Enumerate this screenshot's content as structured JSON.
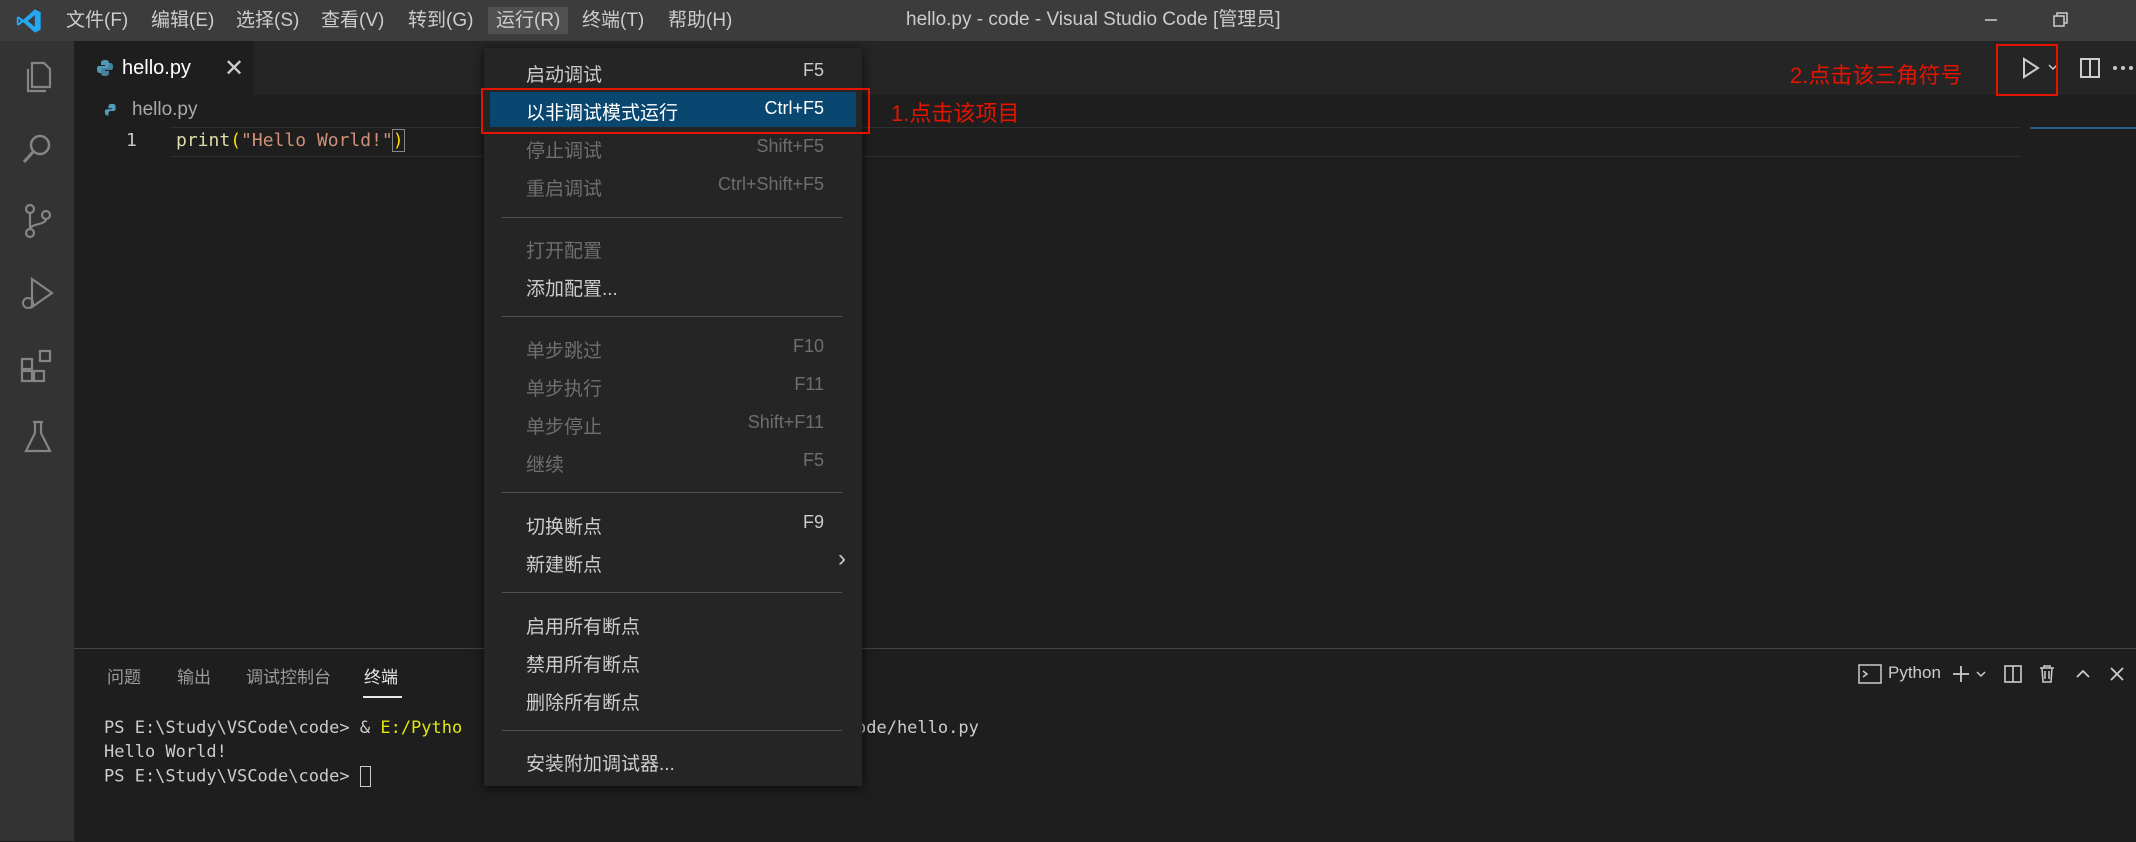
{
  "window": {
    "title": "hello.py - code - Visual Studio Code [管理员]"
  },
  "menubar": [
    "文件(F)",
    "编辑(E)",
    "选择(S)",
    "查看(V)",
    "转到(G)",
    "运行(R)",
    "终端(T)",
    "帮助(H)"
  ],
  "tab": {
    "label": "hello.py",
    "close": "✕"
  },
  "breadcrumb": "hello.py",
  "editor": {
    "line_number": "1",
    "code_fn": "print",
    "code_open": "(",
    "code_string": "\"Hello World!\"",
    "code_close": ")"
  },
  "run_menu": {
    "items": [
      {
        "label": "启动调试",
        "key": "F5"
      },
      {
        "label": "以非调试模式运行",
        "key": "Ctrl+F5"
      },
      {
        "label": "停止调试",
        "key": "Shift+F5"
      },
      {
        "label": "重启调试",
        "key": "Ctrl+Shift+F5"
      },
      {
        "label": "打开配置",
        "key": ""
      },
      {
        "label": "添加配置...",
        "key": ""
      },
      {
        "label": "单步跳过",
        "key": "F10"
      },
      {
        "label": "单步执行",
        "key": "F11"
      },
      {
        "label": "单步停止",
        "key": "Shift+F11"
      },
      {
        "label": "继续",
        "key": "F5"
      },
      {
        "label": "切换断点",
        "key": "F9"
      },
      {
        "label": "新建断点",
        "key": "›"
      },
      {
        "label": "启用所有断点",
        "key": ""
      },
      {
        "label": "禁用所有断点",
        "key": ""
      },
      {
        "label": "删除所有断点",
        "key": ""
      },
      {
        "label": "安装附加调试器...",
        "key": ""
      }
    ]
  },
  "annotations": {
    "step1": "1.点击该项目",
    "step2": "2.点击该三角符号"
  },
  "panel": {
    "tabs": [
      "问题",
      "输出",
      "调试控制台",
      "终端"
    ],
    "terminal_profile": "Python",
    "terminal_lines": {
      "l1_prompt": "PS E:\\Study\\VSCode\\code> & ",
      "l1_path": "E:/Pytho",
      "l1_tail": "ode/hello.py",
      "l2": "Hello World!",
      "l3": "PS E:\\Study\\VSCode\\code> "
    }
  },
  "colors": {
    "accent": "#007acc",
    "highlight": "#094771",
    "annotation": "#e51400",
    "string": "#ce9178",
    "function": "#dcdcaa"
  }
}
